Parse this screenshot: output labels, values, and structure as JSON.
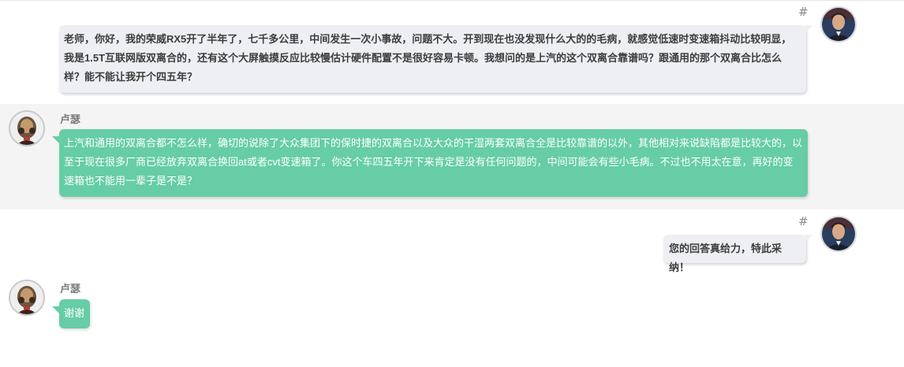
{
  "messages": [
    {
      "role": "user",
      "hash": "#",
      "avatar_icon": "user-avatar-icon",
      "text": "老师，你好，我的荣威RX5开了半年了，七千多公里，中间发生一次小事故，问题不大。开到现在也没发现什么大的的毛病，就感觉低速时变速箱抖动比较明显，我是1.5T互联网版双离合的，还有这个大屏触摸反应比较慢估计硬件配置不是很好容易卡顿。我想问的是上汽的这个双离合靠谱吗？跟通用的那个双离合比怎么样？能不能让我开个四五年？"
    },
    {
      "role": "expert",
      "name": "卢瑟",
      "avatar_icon": "expert-avatar-icon",
      "text": "上汽和通用的双离合都不怎么样，确切的说除了大众集团下的保时捷的双离合以及大众的干湿两套双离合全是比较靠谱的以外，其他相对来说缺陷都是比较大的，以至于现在很多厂商已经放弃双离合换回at或者cvt变速箱了。你这个车四五年开下来肯定是没有任何问题的，中间可能会有些小毛病。不过也不用太在意，再好的变速箱也不能用一辈子是不是？"
    },
    {
      "role": "user",
      "hash": "#",
      "avatar_icon": "user-avatar-icon",
      "text": "您的回答真给力，特此采纳！"
    },
    {
      "role": "expert",
      "name": "卢瑟",
      "avatar_icon": "expert-avatar-icon",
      "text": "谢谢"
    }
  ],
  "colors": {
    "user_bubble": "#eeeff3",
    "expert_bubble": "#66cda7",
    "expert_row_bg": "#f4f4f4",
    "hash": "#8a8a8a"
  }
}
